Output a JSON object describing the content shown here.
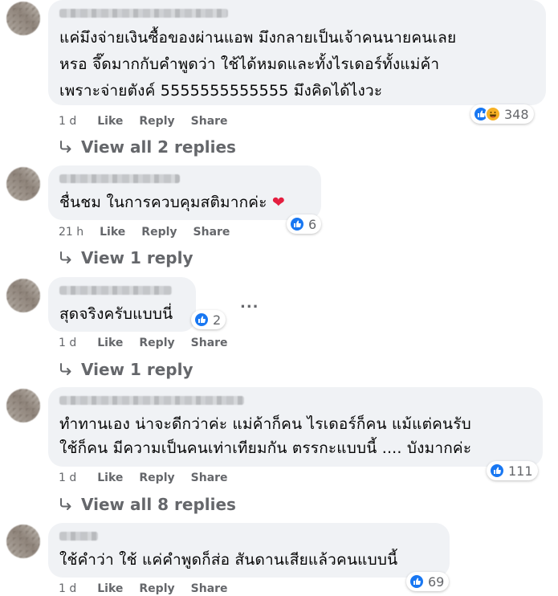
{
  "comments": [
    {
      "body": "แค่มึงจ่ายเงินซื้อของผ่านแอพ มึงกลายเป็นเจ้าคนนายคนเลย\nหรอ จึ๊ดมากกับคำพูดว่า ใช้ได้หมดและทั้งไรเดอร์ทั้งแม่ค้า\nเพราะจ่ายตังค์ 5555555555555 มึงคิดได้ไงวะ",
      "reaction_count": "348",
      "time": "1 d",
      "like": "Like",
      "reply": "Reply",
      "share": "Share",
      "replies_label": "View all 2 replies"
    },
    {
      "body": "ชื่นชม ในการควบคุมสติมากค่ะ",
      "emoji": "❤",
      "reaction_count": "6",
      "time": "21 h",
      "like": "Like",
      "reply": "Reply",
      "share": "Share",
      "replies_label": "View 1 reply"
    },
    {
      "body": "สุดจริงครับแบบนี่",
      "reaction_count": "2",
      "more": "...",
      "time": "1 d",
      "like": "Like",
      "reply": "Reply",
      "share": "Share",
      "replies_label": "View 1 reply"
    },
    {
      "body": "ทำทานเอง น่าจะดีกว่าค่ะ แม่ค้าก็คน ไรเดอร์ก็คน แม้แต่คนรับ\nใช้ก็คน มีความเป็นคนเท่าเทียมกัน ตรรกะแบบนี้ .... บังมากค่ะ",
      "reaction_count": "111",
      "time": "1 d",
      "like": "Like",
      "reply": "Reply",
      "share": "Share",
      "replies_label": "View all 8 replies"
    },
    {
      "body": "ใช้คำว่า ใช้ แค่คำพูดก็ส่อ สันดานเสียแล้วคนแบบนี้",
      "reaction_count": "69",
      "time": "1 d",
      "like": "Like",
      "reply": "Reply",
      "share": "Share"
    }
  ],
  "icons": {
    "like": "like-thumb-icon",
    "haha": "haha-emoji-icon",
    "reply_arrow": "reply-arrow-icon",
    "more": "more-options-icon"
  },
  "colors": {
    "like_blue": "#1877f2",
    "bubble_bg": "#f0f2f5",
    "secondary_text": "#65676b",
    "haha_yellow": "#f7b125",
    "heart_red": "#e41e3f"
  }
}
